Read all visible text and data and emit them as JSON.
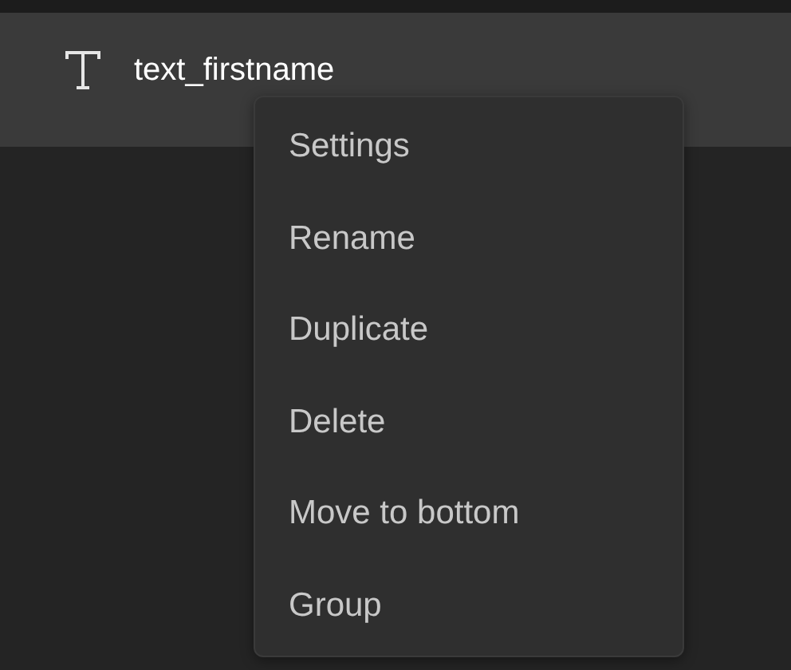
{
  "layer": {
    "name": "text_firstname",
    "selected": true
  },
  "context_menu": {
    "items": [
      {
        "label": "Settings"
      },
      {
        "label": "Rename"
      },
      {
        "label": "Duplicate"
      },
      {
        "label": "Delete"
      },
      {
        "label": "Move to bottom"
      },
      {
        "label": "Group"
      }
    ]
  }
}
